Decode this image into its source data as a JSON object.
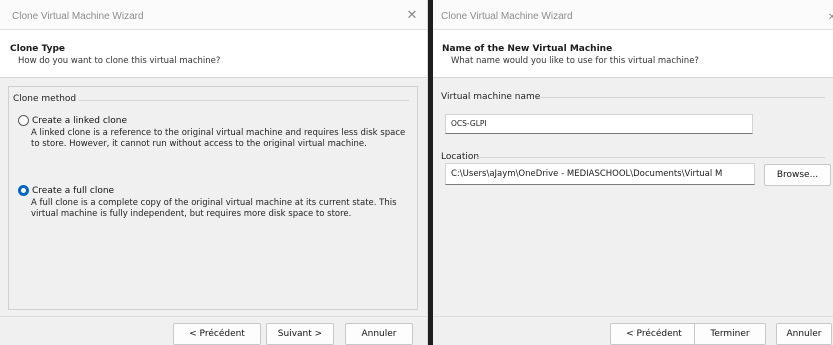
{
  "left_window": {
    "title": "Clone Virtual Machine Wizard",
    "close_glyph": "✕",
    "header": {
      "title": "Clone Type",
      "subtitle": "How do you want to clone this virtual machine?"
    },
    "group_label": "Clone method",
    "options": [
      {
        "label": "Create a linked clone",
        "description": "A linked clone is a reference to the original virtual machine and requires less disk space to store. However, it cannot run without access to the original virtual machine.",
        "checked": false
      },
      {
        "label": "Create a full clone",
        "description": "A full clone is a complete copy of the original virtual machine at its current state. This virtual machine is fully independent, but requires more disk space to store.",
        "checked": true
      }
    ],
    "buttons": {
      "back": "< Précédent",
      "next": "Suivant >",
      "cancel": "Annuler"
    }
  },
  "right_window": {
    "title": "Clone Virtual Machine Wizard",
    "close_glyph": "✕",
    "header": {
      "title": "Name of the New Virtual Machine",
      "subtitle": "What name would you like to use for this virtual machine?"
    },
    "name_label": "Virtual machine name",
    "name_value": "OCS-GLPI",
    "location_label": "Location",
    "location_value": "C:\\Users\\aJaym\\OneDrive - MEDIASCHOOL\\Documents\\Virtual M",
    "browse_label": "Browse...",
    "buttons": {
      "back": "< Précédent",
      "finish": "Terminer",
      "cancel": "Annuler"
    }
  },
  "colors": {
    "radio_selected": "#0067c0",
    "window_bg": "#f0f0f0",
    "header_bg": "#ffffff",
    "divider": "#1e1e1e"
  },
  "icons": [
    "close-icon",
    "radio-unchecked-icon",
    "radio-checked-icon"
  ]
}
